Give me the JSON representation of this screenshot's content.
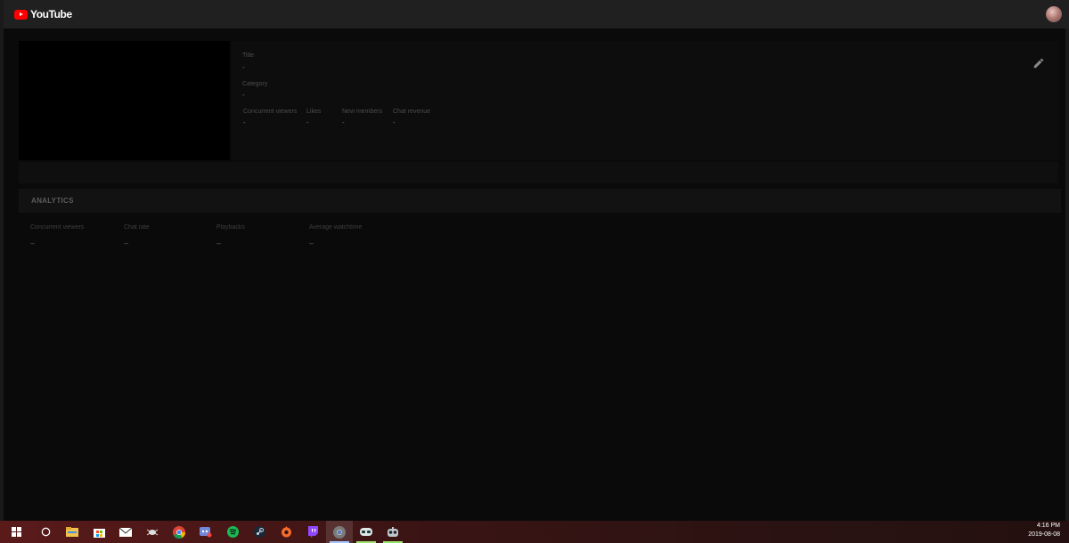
{
  "header": {
    "logo_text": "YouTube",
    "avatar_icon": "user-avatar"
  },
  "stream": {
    "title_label": "Title",
    "title_value": "-",
    "category_label": "Category",
    "category_value": "-",
    "stats": [
      {
        "label": "Concurrent viewers",
        "value": "-"
      },
      {
        "label": "Likes",
        "value": "-"
      },
      {
        "label": "New members",
        "value": "-"
      },
      {
        "label": "Chat revenue",
        "value": "-"
      }
    ],
    "edit_icon": "pencil-icon"
  },
  "analytics": {
    "title": "ANALYTICS",
    "metrics": [
      {
        "label": "Concurrent viewers",
        "value": "–"
      },
      {
        "label": "Chat rate",
        "value": "–"
      },
      {
        "label": "Playbacks",
        "value": "–"
      },
      {
        "label": "Average watchtime",
        "value": "–"
      }
    ]
  },
  "taskbar": {
    "icons": [
      "windows-start-icon",
      "cortana-icon",
      "file-explorer-icon",
      "store-icon",
      "mail-icon",
      "bug-icon",
      "chrome-icon",
      "discord-icon",
      "spotify-icon",
      "steam-icon",
      "origin-icon",
      "twitch-icon",
      "chrome-active-icon",
      "cat-mask-icon",
      "robot-icon"
    ],
    "time": "4:16 PM",
    "date": "2019-08-08"
  },
  "colors": {
    "accent": "#ff0000",
    "background": "#0a0a0a",
    "topbar": "#202020"
  }
}
